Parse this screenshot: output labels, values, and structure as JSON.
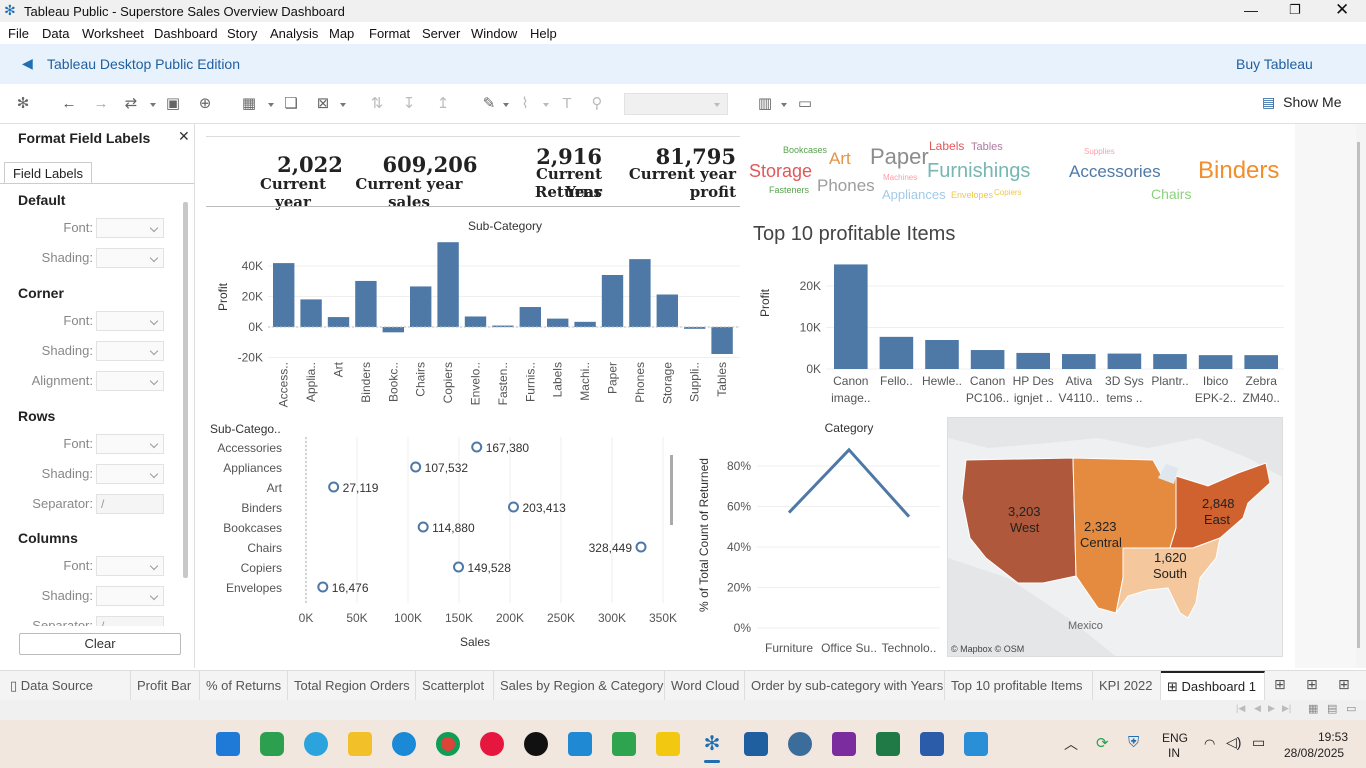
{
  "window": {
    "title": "Tableau Public - Superstore Sales Overview Dashboard"
  },
  "menu": [
    "File",
    "Data",
    "Worksheet",
    "Dashboard",
    "Story",
    "Analysis",
    "Map",
    "Format",
    "Server",
    "Window",
    "Help"
  ],
  "banner": {
    "title": "Tableau Desktop Public Edition",
    "buy": "Buy Tableau"
  },
  "toolbar": {
    "show_me": "Show Me"
  },
  "format_panel": {
    "title": "Format Field Labels",
    "tab": "Field Labels",
    "sections": {
      "default": {
        "title": "Default",
        "font": "Font:",
        "shading": "Shading:"
      },
      "corner": {
        "title": "Corner",
        "font": "Font:",
        "shading": "Shading:",
        "alignment": "Alignment:"
      },
      "rows": {
        "title": "Rows",
        "font": "Font:",
        "shading": "Shading:",
        "separator": "Separator:",
        "separator_value": "/"
      },
      "columns": {
        "title": "Columns",
        "font": "Font:",
        "shading": "Shading:",
        "separator": "Separator:",
        "separator_value": "/"
      }
    },
    "clear": "Clear"
  },
  "kpis": [
    {
      "value": "2,022",
      "label": "Current year"
    },
    {
      "value": "609,206",
      "label": "Current year sales"
    },
    {
      "value": "2,916",
      "label1": "Current Year",
      "label2": "Returns"
    },
    {
      "value": "81,795",
      "label1": "Current year",
      "label2": "profit"
    }
  ],
  "word_cloud": [
    {
      "text": "Bookcases",
      "color": "#5aa95a"
    },
    {
      "text": "Art",
      "color": "#e49444"
    },
    {
      "text": "Paper",
      "color": "#8c8c8c"
    },
    {
      "text": "Labels",
      "color": "#e15759"
    },
    {
      "text": "Tables",
      "color": "#b07aa1"
    },
    {
      "text": "Supplies",
      "color": "#ff9da7"
    },
    {
      "text": "Storage",
      "color": "#e15759"
    },
    {
      "text": "Phones",
      "color": "#9d9d9d"
    },
    {
      "text": "Machines",
      "color": "#ff9da7"
    },
    {
      "text": "Furnishings",
      "color": "#76b7b2"
    },
    {
      "text": "Accessories",
      "color": "#4e79a7"
    },
    {
      "text": "Binders",
      "color": "#f28e2b"
    },
    {
      "text": "Fasteners",
      "color": "#59a14f"
    },
    {
      "text": "Appliances",
      "color": "#a0cbe8"
    },
    {
      "text": "Envelopes",
      "color": "#edc948"
    },
    {
      "text": "Copiers",
      "color": "#edc948"
    },
    {
      "text": "Chairs",
      "color": "#8cd17d"
    }
  ],
  "top10": {
    "title": "Top 10 profitable Items",
    "ylabel": "Profit"
  },
  "map": {
    "regions": [
      {
        "value": "3,203",
        "name": "West"
      },
      {
        "value": "2,323",
        "name": "Central"
      },
      {
        "value": "2,848",
        "name": "East"
      },
      {
        "value": "1,620",
        "name": "South"
      }
    ],
    "mexico": "Mexico",
    "credit": "© Mapbox © OSM"
  },
  "chart_data": [
    {
      "type": "bar",
      "title": "Sub-Category",
      "ylabel": "Profit",
      "ylim": [
        -24000,
        60000
      ],
      "yticks": [
        "40K",
        "20K",
        "0K",
        "-20K"
      ],
      "categories": [
        "Access..",
        "Applia..",
        "Art",
        "Binders",
        "Bookc..",
        "Chairs",
        "Copiers",
        "Envelo..",
        "Fasten..",
        "Furnis..",
        "Labels",
        "Machi..",
        "Paper",
        "Phones",
        "Storage",
        "Suppli..",
        "Tables"
      ],
      "values": [
        41900,
        18100,
        6500,
        30200,
        -3500,
        26600,
        55600,
        6900,
        950,
        13100,
        5500,
        3400,
        34100,
        44500,
        21300,
        -1200,
        -17700
      ],
      "color": "#4e79a7"
    },
    {
      "type": "bar",
      "title": "Top 10 profitable Items",
      "ylabel": "Profit",
      "yticks": [
        "20K",
        "10K",
        "0K"
      ],
      "ylim": [
        0,
        27000
      ],
      "categories": [
        [
          "Canon",
          "image.."
        ],
        [
          "Fello..",
          ""
        ],
        [
          "Hewle..",
          ""
        ],
        [
          "Canon",
          "PC106.."
        ],
        [
          "HP Des",
          "ignjet .."
        ],
        [
          "Ativa",
          "V4110.."
        ],
        [
          "3D Sys",
          "tems .."
        ],
        [
          "Plantr..",
          ""
        ],
        [
          "Ibico",
          "EPK-2.."
        ],
        [
          "Zebra",
          "ZM40.."
        ]
      ],
      "values": [
        25200,
        7750,
        6990,
        4570,
        3870,
        3600,
        3720,
        3600,
        3340,
        3340
      ],
      "color": "#4e79a7"
    },
    {
      "type": "scatter",
      "ylabel": "Sub-Catego..",
      "xlabel": "Sales",
      "xticks": [
        "0K",
        "50K",
        "100K",
        "150K",
        "200K",
        "250K",
        "300K",
        "350K"
      ],
      "xlim": [
        0,
        360000
      ],
      "categories": [
        "Accessories",
        "Appliances",
        "Art",
        "Binders",
        "Bookcases",
        "Chairs",
        "Copiers",
        "Envelopes"
      ],
      "values": [
        167380,
        107532,
        27119,
        203413,
        114880,
        328449,
        149528,
        16476
      ],
      "labels": [
        "167,380",
        "107,532",
        "27,119",
        "203,413",
        "114,880",
        "328,449",
        "149,528",
        "16,476"
      ],
      "color": "#4e79a7"
    },
    {
      "type": "line",
      "title": "Category",
      "ylabel": "% of Total Count of Returned",
      "yticks": [
        "80%",
        "60%",
        "40%",
        "20%",
        "0%"
      ],
      "ylim": [
        0,
        90
      ],
      "categories": [
        "Furniture",
        "Office Su..",
        "Technolo.."
      ],
      "values": [
        57,
        88,
        55
      ],
      "color": "#4e79a7"
    }
  ],
  "tabs": [
    "Data Source",
    "Profit Bar",
    "% of Returns",
    "Total Region Orders",
    "Scatterplot",
    "Sales by Region & Category",
    "Word Cloud",
    "Order by sub-category with Years",
    "Top 10 profitable Items",
    "KPI 2022",
    "Dashboard 1"
  ],
  "taskbar": {
    "lang1": "ENG",
    "lang2": "IN",
    "time": "19:53",
    "date": "28/08/2025"
  }
}
